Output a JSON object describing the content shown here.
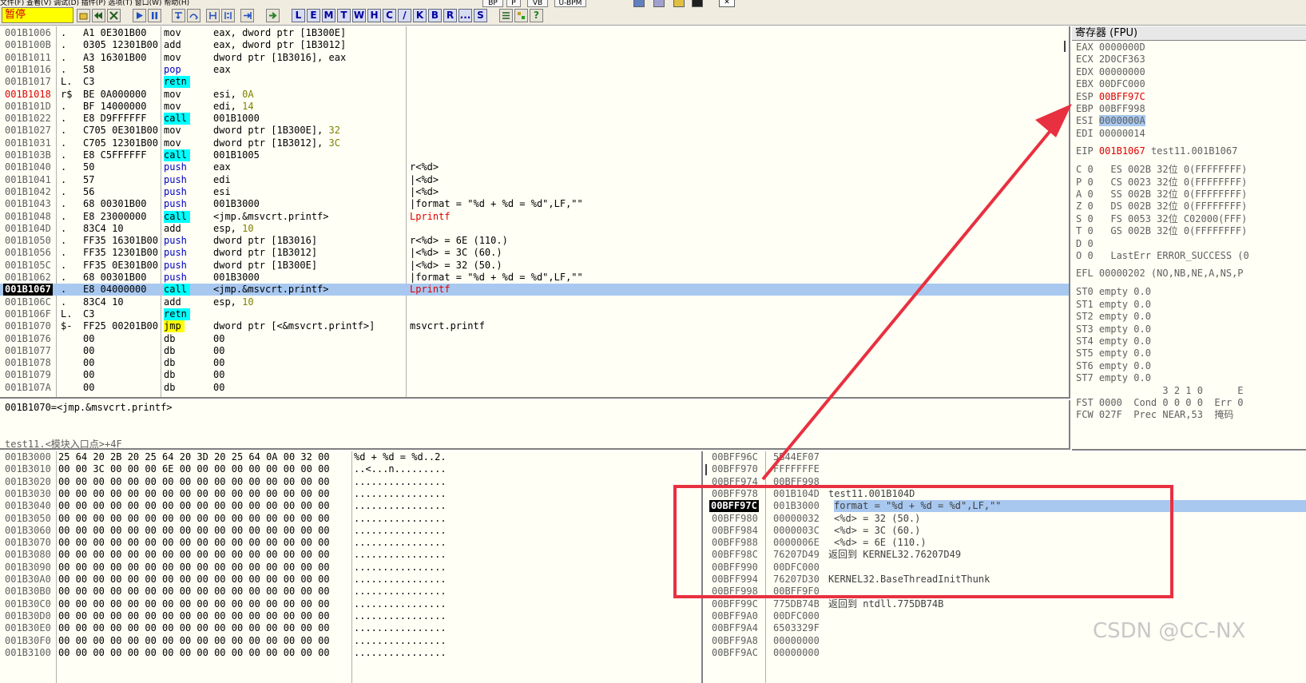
{
  "window": {
    "status_label": "暂停",
    "menu_text": "文件(F)  查看(V)  调试(D)  插件(P)  选项(T)  窗口(W)  帮助(H)",
    "top_tabs": [
      "BP",
      "P",
      "VB",
      "U-BPM"
    ]
  },
  "toolbar": {
    "letters": [
      "L",
      "E",
      "M",
      "T",
      "W",
      "H",
      "C",
      "/",
      "K",
      "B",
      "R",
      "...",
      "S"
    ]
  },
  "disasm": {
    "rows": [
      {
        "addr": "001B1006",
        "marker": ".",
        "hex": "A1 0E301B00",
        "mnem": "mov",
        "oper": "eax, dword ptr [1B300E]",
        "comment": ""
      },
      {
        "addr": "001B100B",
        "marker": ".",
        "hex": "0305 12301B00",
        "mnem": "add",
        "oper": "eax, dword ptr [1B3012]",
        "comment": ""
      },
      {
        "addr": "001B1011",
        "marker": ".",
        "hex": "A3 16301B00",
        "mnem": "mov",
        "oper": "dword ptr [1B3016], eax",
        "comment": ""
      },
      {
        "addr": "001B1016",
        "marker": ".",
        "hex": "58",
        "mnem": "pop",
        "oper": "eax",
        "comment": ""
      },
      {
        "addr": "001B1017",
        "marker": "L.",
        "hex": "C3",
        "mnem": "retn",
        "oper": "",
        "comment": ""
      },
      {
        "addr": "001B1018",
        "marker": "r$",
        "hex": "BE 0A000000",
        "mnem": "mov",
        "oper": "esi, 0A",
        "comment": ""
      },
      {
        "addr": "001B101D",
        "marker": ".",
        "hex": "BF 14000000",
        "mnem": "mov",
        "oper": "edi, 14",
        "comment": ""
      },
      {
        "addr": "001B1022",
        "marker": ".",
        "hex": "E8 D9FFFFFF",
        "mnem": "call",
        "oper": "001B1000",
        "comment": ""
      },
      {
        "addr": "001B1027",
        "marker": ".",
        "hex": "C705 0E301B00",
        "mnem": "mov",
        "oper": "dword ptr [1B300E], 32",
        "comment": ""
      },
      {
        "addr": "001B1031",
        "marker": ".",
        "hex": "C705 12301B00",
        "mnem": "mov",
        "oper": "dword ptr [1B3012], 3C",
        "comment": ""
      },
      {
        "addr": "001B103B",
        "marker": ".",
        "hex": "E8 C5FFFFFF",
        "mnem": "call",
        "oper": "001B1005",
        "comment": ""
      },
      {
        "addr": "001B1040",
        "marker": ".",
        "hex": "50",
        "mnem": "push",
        "oper": "eax",
        "comment": "r<%d>"
      },
      {
        "addr": "001B1041",
        "marker": ".",
        "hex": "57",
        "mnem": "push",
        "oper": "edi",
        "comment": "|<%d>"
      },
      {
        "addr": "001B1042",
        "marker": ".",
        "hex": "56",
        "mnem": "push",
        "oper": "esi",
        "comment": "|<%d>"
      },
      {
        "addr": "001B1043",
        "marker": ".",
        "hex": "68 00301B00",
        "mnem": "push",
        "oper": "001B3000",
        "comment": "|format = \"%d + %d = %d\",LF,\"\""
      },
      {
        "addr": "001B1048",
        "marker": ".",
        "hex": "E8 23000000",
        "mnem": "call",
        "oper": "<jmp.&msvcrt.printf>",
        "comment": "Lprintf"
      },
      {
        "addr": "001B104D",
        "marker": ".",
        "hex": "83C4 10",
        "mnem": "add",
        "oper": "esp, 10",
        "comment": ""
      },
      {
        "addr": "001B1050",
        "marker": ".",
        "hex": "FF35 16301B00",
        "mnem": "push",
        "oper": "dword ptr [1B3016]",
        "comment": "r<%d> = 6E (110.)"
      },
      {
        "addr": "001B1056",
        "marker": ".",
        "hex": "FF35 12301B00",
        "mnem": "push",
        "oper": "dword ptr [1B3012]",
        "comment": "|<%d> = 3C (60.)"
      },
      {
        "addr": "001B105C",
        "marker": ".",
        "hex": "FF35 0E301B00",
        "mnem": "push",
        "oper": "dword ptr [1B300E]",
        "comment": "|<%d> = 32 (50.)"
      },
      {
        "addr": "001B1062",
        "marker": ".",
        "hex": "68 00301B00",
        "mnem": "push",
        "oper": "001B3000",
        "comment": "|format = \"%d + %d = %d\",LF,\"\""
      },
      {
        "addr": "001B1067",
        "marker": ".",
        "hex": "E8 04000000",
        "mnem": "call",
        "oper": "<jmp.&msvcrt.printf>",
        "comment": "Lprintf"
      },
      {
        "addr": "001B106C",
        "marker": ".",
        "hex": "83C4 10",
        "mnem": "add",
        "oper": "esp, 10",
        "comment": ""
      },
      {
        "addr": "001B106F",
        "marker": "L.",
        "hex": "C3",
        "mnem": "retn",
        "oper": "",
        "comment": ""
      },
      {
        "addr": "001B1070",
        "marker": "$-",
        "hex": "FF25 00201B00",
        "mnem": "jmp",
        "oper": "dword ptr [<&msvcrt.printf>]",
        "comment": "msvcrt.printf"
      },
      {
        "addr": "001B1076",
        "marker": "",
        "hex": "00",
        "mnem": "db",
        "oper": "00",
        "comment": ""
      },
      {
        "addr": "001B1077",
        "marker": "",
        "hex": "00",
        "mnem": "db",
        "oper": "00",
        "comment": ""
      },
      {
        "addr": "001B1078",
        "marker": "",
        "hex": "00",
        "mnem": "db",
        "oper": "00",
        "comment": ""
      },
      {
        "addr": "001B1079",
        "marker": "",
        "hex": "00",
        "mnem": "db",
        "oper": "00",
        "comment": ""
      },
      {
        "addr": "001B107A",
        "marker": "",
        "hex": "00",
        "mnem": "db",
        "oper": "00",
        "comment": ""
      }
    ],
    "current_addr": "001B1067",
    "entry_addr": "001B1018"
  },
  "info": {
    "line1": "001B1070=<jmp.&msvcrt.printf>",
    "line2": "test11.<模块入口点>+4F"
  },
  "registers": {
    "title": "寄存器 (FPU)",
    "gp": [
      {
        "name": "EAX",
        "value": "0000000D"
      },
      {
        "name": "ECX",
        "value": "2D0CF363"
      },
      {
        "name": "EDX",
        "value": "00000000"
      },
      {
        "name": "EBX",
        "value": "00DFC000"
      },
      {
        "name": "ESP",
        "value": "00BFF97C"
      },
      {
        "name": "EBP",
        "value": "00BFF998"
      },
      {
        "name": "ESI",
        "value": "0000000A"
      },
      {
        "name": "EDI",
        "value": "00000014"
      }
    ],
    "eip": {
      "name": "EIP",
      "value": "001B1067",
      "comment": "test11.001B1067"
    },
    "flags": [
      "C 0   ES 002B 32位 0(FFFFFFFF)",
      "P 0   CS 0023 32位 0(FFFFFFFF)",
      "A 0   SS 002B 32位 0(FFFFFFFF)",
      "Z 0   DS 002B 32位 0(FFFFFFFF)",
      "S 0   FS 0053 32位 C02000(FFF)",
      "T 0   GS 002B 32位 0(FFFFFFFF)",
      "D 0",
      "O 0   LastErr ERROR_SUCCESS (0"
    ],
    "efl": "EFL 00000202 (NO,NB,NE,A,NS,P",
    "fpu": [
      "ST0 empty 0.0",
      "ST1 empty 0.0",
      "ST2 empty 0.0",
      "ST3 empty 0.0",
      "ST4 empty 0.0",
      "ST5 empty 0.0",
      "ST6 empty 0.0",
      "ST7 empty 0.0"
    ],
    "fst_header": "               3 2 1 0      E",
    "fst": "FST 0000  Cond 0 0 0 0  Err 0",
    "fcw": "FCW 027F  Prec NEAR,53  掩码"
  },
  "dump": {
    "rows": [
      {
        "addr": "001B3000",
        "hex": "25 64 20 2B 20 25 64 20 3D 20 25 64 0A 00 32 00",
        "ascii": "%d + %d = %d..2."
      },
      {
        "addr": "001B3010",
        "hex": "00 00 3C 00 00 00 6E 00 00 00 00 00 00 00 00 00",
        "ascii": "..<...n........."
      },
      {
        "addr": "001B3020",
        "hex": "00 00 00 00 00 00 00 00 00 00 00 00 00 00 00 00",
        "ascii": "................"
      },
      {
        "addr": "001B3030",
        "hex": "00 00 00 00 00 00 00 00 00 00 00 00 00 00 00 00",
        "ascii": "................"
      },
      {
        "addr": "001B3040",
        "hex": "00 00 00 00 00 00 00 00 00 00 00 00 00 00 00 00",
        "ascii": "................"
      },
      {
        "addr": "001B3050",
        "hex": "00 00 00 00 00 00 00 00 00 00 00 00 00 00 00 00",
        "ascii": "................"
      },
      {
        "addr": "001B3060",
        "hex": "00 00 00 00 00 00 00 00 00 00 00 00 00 00 00 00",
        "ascii": "................"
      },
      {
        "addr": "001B3070",
        "hex": "00 00 00 00 00 00 00 00 00 00 00 00 00 00 00 00",
        "ascii": "................"
      },
      {
        "addr": "001B3080",
        "hex": "00 00 00 00 00 00 00 00 00 00 00 00 00 00 00 00",
        "ascii": "................"
      },
      {
        "addr": "001B3090",
        "hex": "00 00 00 00 00 00 00 00 00 00 00 00 00 00 00 00",
        "ascii": "................"
      },
      {
        "addr": "001B30A0",
        "hex": "00 00 00 00 00 00 00 00 00 00 00 00 00 00 00 00",
        "ascii": "................"
      },
      {
        "addr": "001B30B0",
        "hex": "00 00 00 00 00 00 00 00 00 00 00 00 00 00 00 00",
        "ascii": "................"
      },
      {
        "addr": "001B30C0",
        "hex": "00 00 00 00 00 00 00 00 00 00 00 00 00 00 00 00",
        "ascii": "................"
      },
      {
        "addr": "001B30D0",
        "hex": "00 00 00 00 00 00 00 00 00 00 00 00 00 00 00 00",
        "ascii": "................"
      },
      {
        "addr": "001B30E0",
        "hex": "00 00 00 00 00 00 00 00 00 00 00 00 00 00 00 00",
        "ascii": "................"
      },
      {
        "addr": "001B30F0",
        "hex": "00 00 00 00 00 00 00 00 00 00 00 00 00 00 00 00",
        "ascii": "................"
      },
      {
        "addr": "001B3100",
        "hex": "00 00 00 00 00 00 00 00 00 00 00 00 00 00 00 00",
        "ascii": "................"
      }
    ]
  },
  "stack": {
    "rows": [
      {
        "addr": "00BFF96C",
        "value": "5B44EF07",
        "comment": ""
      },
      {
        "addr": "00BFF970",
        "value": "FFFFFFFE",
        "comment": ""
      },
      {
        "addr": "00BFF974",
        "value": "00BFF998",
        "comment": ""
      },
      {
        "addr": "00BFF978",
        "value": "001B104D",
        "comment": "test11.001B104D"
      },
      {
        "addr": "00BFF97C",
        "value": "001B3000",
        "comment": "format = \"%d + %d = %d\",LF,\"\""
      },
      {
        "addr": "00BFF980",
        "value": "00000032",
        "comment": "<%d> = 32 (50.)"
      },
      {
        "addr": "00BFF984",
        "value": "0000003C",
        "comment": "<%d> = 3C (60.)"
      },
      {
        "addr": "00BFF988",
        "value": "0000006E",
        "comment": "<%d> = 6E (110.)"
      },
      {
        "addr": "00BFF98C",
        "value": "76207D49",
        "comment": "返回到 KERNEL32.76207D49"
      },
      {
        "addr": "00BFF990",
        "value": "00DFC000",
        "comment": ""
      },
      {
        "addr": "00BFF994",
        "value": "76207D30",
        "comment": "KERNEL32.BaseThreadInitThunk"
      },
      {
        "addr": "00BFF998",
        "value": "00BFF9F0",
        "comment": ""
      },
      {
        "addr": "00BFF99C",
        "value": "775DB74B",
        "comment": "返回到 ntdll.775DB74B"
      },
      {
        "addr": "00BFF9A0",
        "value": "00DFC000",
        "comment": ""
      },
      {
        "addr": "00BFF9A4",
        "value": "6503329F",
        "comment": ""
      },
      {
        "addr": "00BFF9A8",
        "value": "00000000",
        "comment": ""
      },
      {
        "addr": "00BFF9AC",
        "value": "00000000",
        "comment": ""
      }
    ],
    "current_addr": "00BFF97C"
  },
  "watermark": "CSDN @CC-NX",
  "colors": {
    "annotation": "#e83040",
    "selection": "#a8c8f0",
    "status": "#ffff00"
  }
}
